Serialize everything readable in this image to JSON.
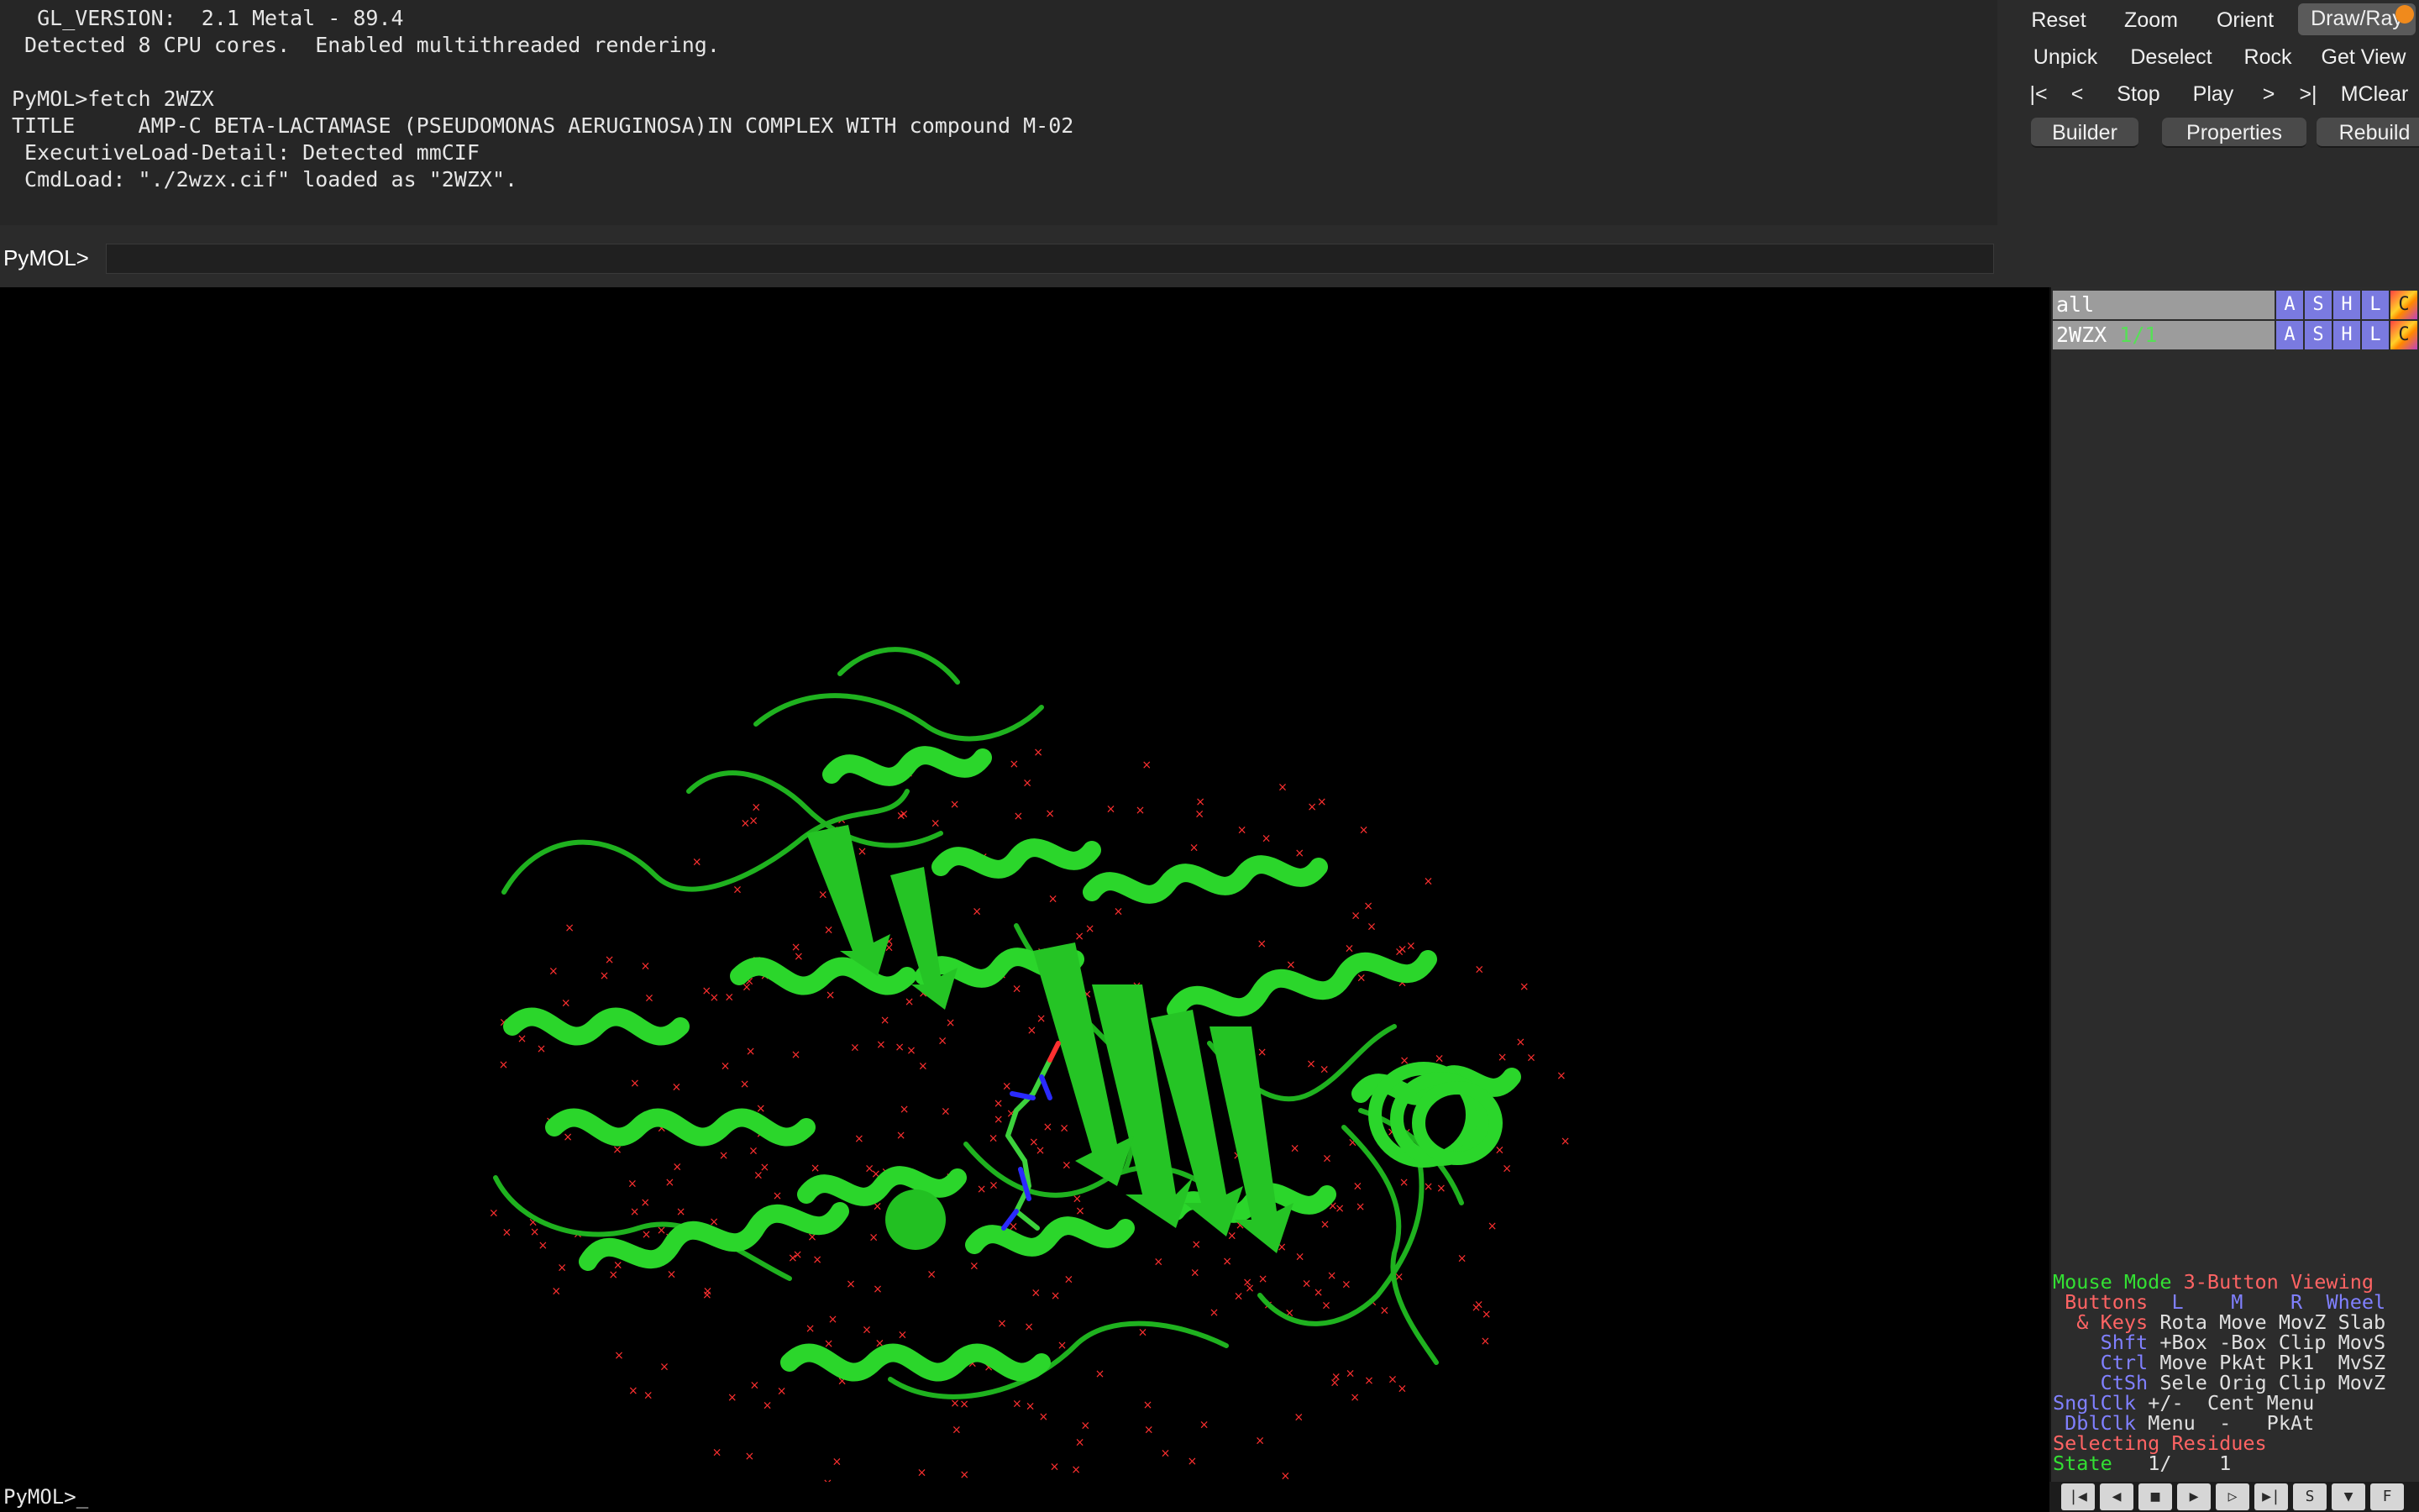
{
  "console": {
    "lines": [
      "  GL_VERSION:  2.1 Metal - 89.4",
      " Detected 8 CPU cores.  Enabled multithreaded rendering.",
      "",
      "PyMOL>fetch 2WZX",
      "TITLE     AMP-C BETA-LACTAMASE (PSEUDOMONAS AERUGINOSA)IN COMPLEX WITH compound M-02",
      " ExecutiveLoad-Detail: Detected mmCIF",
      " CmdLoad: \"./2wzx.cif\" loaded as \"2WZX\"."
    ],
    "prompt": "PyMOL>",
    "input_value": ""
  },
  "buttons": {
    "reset": "Reset",
    "zoom": "Zoom",
    "orient": "Orient",
    "draw_ray": "Draw/Ray",
    "unpick": "Unpick",
    "deselect": "Deselect",
    "rock": "Rock",
    "get_view": "Get View",
    "first": "|<",
    "prev": "<",
    "stop": "Stop",
    "play": "Play",
    "next": ">",
    "last": ">|",
    "mclear": "MClear",
    "builder": "Builder",
    "properties": "Properties",
    "rebuild": "Rebuild"
  },
  "objects": [
    {
      "name": "all",
      "state": "",
      "buttons": [
        "A",
        "S",
        "H",
        "L",
        "C"
      ]
    },
    {
      "name": "2WZX",
      "state": "1/1",
      "buttons": [
        "A",
        "S",
        "H",
        "L",
        "C"
      ]
    }
  ],
  "mouse_legend": {
    "mode_label": "Mouse Mode",
    "mode_value": "3-Button Viewing",
    "buttons_label": "Buttons",
    "col_l": "L",
    "col_m": "M",
    "col_r": "R",
    "col_wheel": "Wheel",
    "keys_label": "& Keys",
    "keys_row": "Rota Move MovZ Slab",
    "shft_label": "Shft",
    "shft_row": "+Box -Box Clip MovS",
    "ctrl_label": "Ctrl",
    "ctrl_row": "Move PkAt Pk1  MvSZ",
    "ctsh_label": "CtSh",
    "ctsh_row": "Sele Orig Clip MovZ",
    "snglclk_label": "SnglClk",
    "snglclk_row": "+/-  Cent Menu",
    "dblclk_label": "DblClk",
    "dblclk_row": "Menu  -   PkAt",
    "selecting": "Selecting Residues",
    "state_label": "State",
    "state_value": "1/    1"
  },
  "bottom_prompt": "PyMOL>_",
  "player_controls": [
    "|◀",
    "◀",
    "■",
    "▶",
    "▷",
    "▶|",
    "S",
    "▼",
    "F"
  ],
  "colors": {
    "cartoon": "#2bd62b",
    "water": "#ff3030",
    "background": "#000000",
    "accent_green": "#33e033",
    "accent_red": "#ff6464",
    "accent_blue": "#8080ff"
  }
}
